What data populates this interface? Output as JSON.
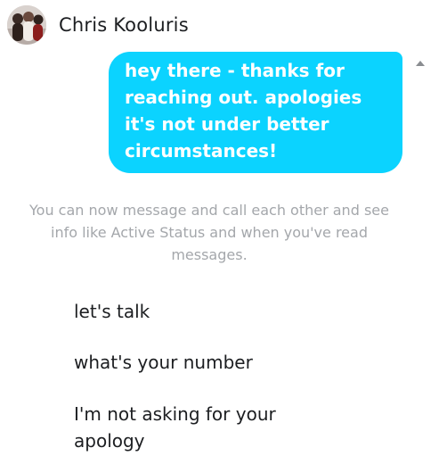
{
  "contact": {
    "name": "Chris Kooluris",
    "avatar_icon": "profile-photo"
  },
  "conversation": {
    "sent_message": "hey there - thanks for reaching out. apologies it's not under better circumstances!",
    "sent_bubble_color": "#0bd3ff",
    "system_note": "You can now message and call each other and see info like Active Status and when you've read messages.",
    "received_messages": [
      "let's talk",
      "what's your number",
      "I'm not asking for your apology"
    ]
  },
  "scrollbar": {
    "up_arrow_icon": "triangle-up-icon"
  }
}
